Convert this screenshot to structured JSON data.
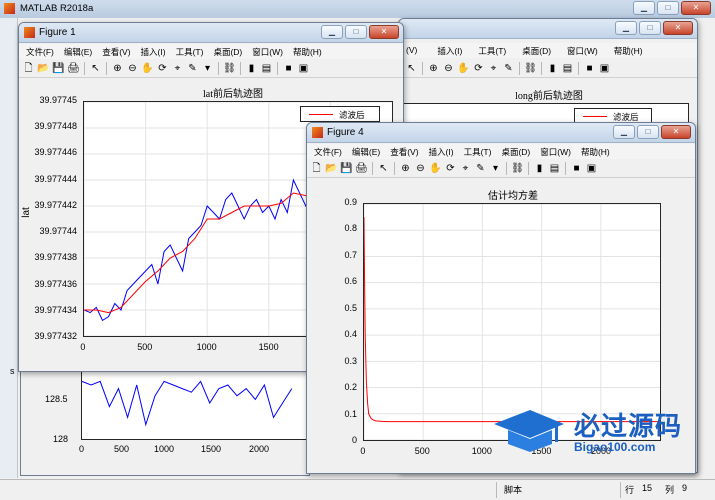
{
  "matlab": {
    "title": "MATLAB R2018a",
    "statusbar": {
      "script_label": "脚本",
      "row_label": "行",
      "row_value": "15",
      "col_label": "列",
      "col_value": "9"
    },
    "left_strip": [
      "s"
    ]
  },
  "menus": [
    "文件(F)",
    "编辑(E)",
    "查看(V)",
    "插入(I)",
    "工具(T)",
    "桌面(D)",
    "窗口(W)",
    "帮助(H)"
  ],
  "figure1": {
    "title": "Figure 1",
    "plot_title": "lat前后轨迹图",
    "ylabel": "lat",
    "legend": "滤波后",
    "colors": {
      "raw": "#0000ff",
      "filtered": "#ff0000"
    }
  },
  "figure2": {
    "menus_partial": [
      "(V)",
      "插入(I)",
      "工具(T)",
      "桌面(D)",
      "窗口(W)",
      "帮助(H)"
    ],
    "plot_title": "long前后轨迹图",
    "legend": "滤波后"
  },
  "figure4": {
    "title": "Figure 4",
    "plot_title": "估计均方差"
  },
  "watermark": {
    "main": "必过源码",
    "sub": "Bigao100.com"
  },
  "chart_data": [
    {
      "type": "line",
      "title": "lat前后轨迹图",
      "ylabel": "lat",
      "xlabel": "",
      "xlim": [
        0,
        2500
      ],
      "ylim": [
        39.977432,
        39.97745
      ],
      "xticks": [
        "0",
        "500",
        "1000",
        "1500",
        "2000"
      ],
      "yticks": [
        "39.97745",
        "39.977448",
        "39.977446",
        "39.977444",
        "39.977442",
        "39.97744",
        "39.977438",
        "39.977436",
        "39.977434",
        "39.977432"
      ],
      "legend": "滤波后",
      "grid": true,
      "series": [
        {
          "name": "",
          "color": "#0000ff",
          "x": [
            0,
            50,
            100,
            150,
            200,
            250,
            300,
            350,
            400,
            450,
            500,
            550,
            600,
            650,
            700,
            750,
            800,
            850,
            900,
            950,
            1000,
            1050,
            1100,
            1150,
            1200,
            1250,
            1300,
            1350,
            1400,
            1450,
            1500,
            1550,
            1600,
            1650,
            1700,
            1750,
            1800,
            1850,
            1900,
            1950,
            2000,
            2050,
            2100,
            2150,
            2200,
            2250,
            2300,
            2350,
            2400,
            2450,
            2500
          ],
          "y": [
            39.977434,
            39.9774338,
            39.9774342,
            39.9774332,
            39.9774335,
            39.9774345,
            39.977434,
            39.9774355,
            39.977436,
            39.9774365,
            39.977437,
            39.9774375,
            39.977436,
            39.9774385,
            39.977439,
            39.977438,
            39.977437,
            39.9774395,
            39.97744,
            39.9774405,
            39.977442,
            39.9774415,
            39.977441,
            39.9774425,
            39.977443,
            39.977442,
            39.977441,
            39.977442,
            39.9774425,
            39.9774415,
            39.977442,
            39.977441,
            39.9774425,
            39.9774415,
            39.977444,
            39.977443,
            39.977442,
            39.977443,
            39.9774425,
            39.977444,
            39.9774445,
            39.977446,
            39.977447,
            39.977448,
            39.9774475,
            39.9774465,
            39.9774445,
            39.977442,
            39.977443,
            39.977445,
            39.977446
          ]
        },
        {
          "name": "滤波后",
          "color": "#ff0000",
          "x": [
            0,
            100,
            200,
            300,
            400,
            500,
            600,
            700,
            800,
            900,
            1000,
            1100,
            1200,
            1300,
            1400,
            1500,
            1600,
            1700,
            1800,
            1900,
            2000,
            2100,
            2200,
            2300,
            2400,
            2500
          ],
          "y": [
            39.977434,
            39.977434,
            39.9774338,
            39.9774342,
            39.9774352,
            39.9774362,
            39.977437,
            39.977438,
            39.9774385,
            39.9774395,
            39.977441,
            39.977441,
            39.9774415,
            39.977442,
            39.977442,
            39.977442,
            39.9774422,
            39.977443,
            39.9774428,
            39.9774432,
            39.977444,
            39.9774455,
            39.9774465,
            39.9774455,
            39.977444,
            39.9774455
          ]
        }
      ]
    },
    {
      "type": "line",
      "title": "long前后轨迹图",
      "xlim": [
        0,
        2500
      ],
      "ylim": [
        128,
        129
      ],
      "xticks": [
        "0",
        "500",
        "1000",
        "1500",
        "2000"
      ],
      "yticks": [
        "128.5",
        "128"
      ],
      "legend": "滤波后",
      "series": [
        {
          "name": "",
          "color": "#0000ff",
          "x": [
            0,
            100,
            200,
            300,
            400,
            500,
            600,
            700,
            800,
            900,
            1000,
            1100,
            1200,
            1300,
            1400,
            1500,
            1600,
            1700,
            1800,
            1900,
            2000,
            2100,
            2200,
            2300
          ],
          "y": [
            128.8,
            128.75,
            128.8,
            128.45,
            128.7,
            128.3,
            128.75,
            128.2,
            128.6,
            128.8,
            128.75,
            128.7,
            128.65,
            128.8,
            128.5,
            128.7,
            128.75,
            128.6,
            128.7,
            128.55,
            128.75,
            128.3,
            128.5,
            128.7
          ]
        }
      ]
    },
    {
      "type": "line",
      "title": "估计均方差",
      "xlim": [
        0,
        2500
      ],
      "ylim": [
        0,
        0.9
      ],
      "xticks": [
        "0",
        "500",
        "1000",
        "1500",
        "2000"
      ],
      "yticks": [
        "0.9",
        "0.8",
        "0.7",
        "0.6",
        "0.5",
        "0.4",
        "0.3",
        "0.2",
        "0.1",
        "0"
      ],
      "grid": true,
      "series": [
        {
          "name": "",
          "color": "#ff0000",
          "x": [
            0,
            5,
            10,
            20,
            30,
            40,
            60,
            80,
            100,
            150,
            200,
            300,
            500,
            1000,
            1500,
            2000,
            2500
          ],
          "y": [
            0.85,
            0.6,
            0.4,
            0.22,
            0.14,
            0.1,
            0.082,
            0.076,
            0.073,
            0.071,
            0.07,
            0.07,
            0.07,
            0.07,
            0.07,
            0.07,
            0.07
          ]
        }
      ]
    }
  ]
}
